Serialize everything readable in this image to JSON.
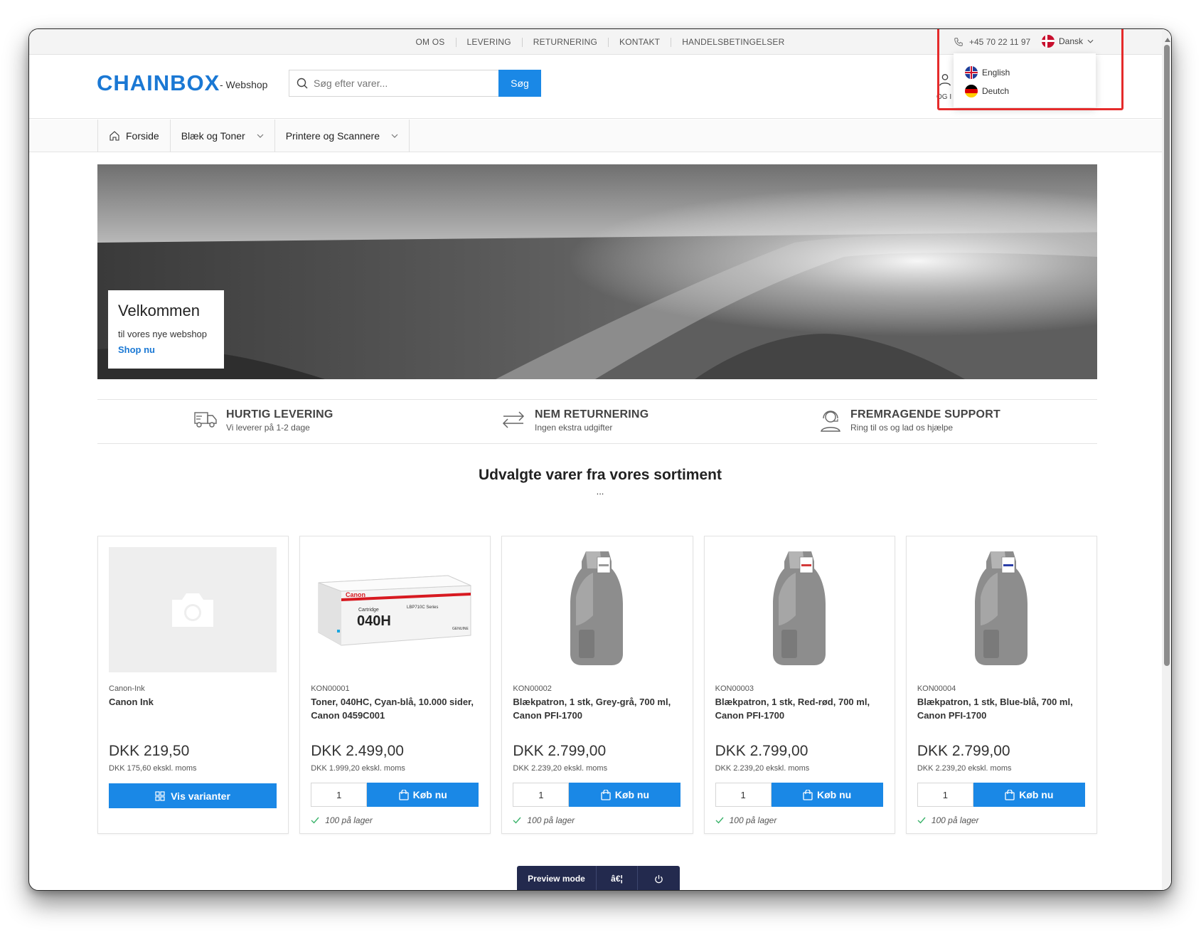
{
  "topbar": {
    "links": [
      "OM OS",
      "LEVERING",
      "RETURNERING",
      "KONTAKT",
      "HANDELSBETINGELSER"
    ],
    "phone": "+45 70 22 11 97",
    "language": "Dansk",
    "language_options": [
      "English",
      "Deutch"
    ]
  },
  "header": {
    "logo": "CHAINBOX",
    "logo_sub": "- Webshop",
    "search_placeholder": "Søg efter varer...",
    "search_button": "Søg",
    "account_label": "OG I"
  },
  "nav": {
    "items": [
      {
        "label": "Forside",
        "icon": "home-icon"
      },
      {
        "label": "Blæk og Toner",
        "icon": "chevron-down-icon"
      },
      {
        "label": "Printere og Scannere",
        "icon": "chevron-down-icon"
      }
    ]
  },
  "hero": {
    "title": "Velkommen",
    "text": "til vores nye webshop",
    "link": "Shop nu"
  },
  "features": [
    {
      "title": "HURTIG LEVERING",
      "sub": "Vi leverer på 1-2 dage",
      "icon": "truck-icon"
    },
    {
      "title": "NEM RETURNERING",
      "sub": "Ingen ekstra udgifter",
      "icon": "return-arrows-icon"
    },
    {
      "title": "FREMRAGENDE SUPPORT",
      "sub": "Ring til os og lad os hjælpe",
      "icon": "support-headset-icon"
    }
  ],
  "section": {
    "title": "Udvalgte varer fra vores sortiment",
    "dots": "..."
  },
  "products": [
    {
      "sku": "Canon-Ink",
      "name": "Canon Ink",
      "price": "DKK 219,50",
      "price_ex": "DKK 175,60 ekskl. moms",
      "button": "Vis varianter",
      "image": "placeholder"
    },
    {
      "sku": "KON00001",
      "name": "Toner, 040HC, Cyan-blå, 10.000 sider, Canon 0459C001",
      "price": "DKK 2.499,00",
      "price_ex": "DKK 1.999,20 ekskl. moms",
      "qty": "1",
      "button": "Køb nu",
      "stock": "100 på lager",
      "image": "toner-box"
    },
    {
      "sku": "KON00002",
      "name": "Blækpatron, 1 stk, Grey-grå, 700 ml, Canon PFI-1700",
      "price": "DKK 2.799,00",
      "price_ex": "DKK 2.239,20 ekskl. moms",
      "qty": "1",
      "button": "Køb nu",
      "stock": "100 på lager",
      "image": "ink-cartridge",
      "accent": "#9a9a9a"
    },
    {
      "sku": "KON00003",
      "name": "Blækpatron, 1 stk, Red-rød, 700 ml, Canon PFI-1700",
      "price": "DKK 2.799,00",
      "price_ex": "DKK 2.239,20 ekskl. moms",
      "qty": "1",
      "button": "Køb nu",
      "stock": "100 på lager",
      "image": "ink-cartridge",
      "accent": "#d23a3a"
    },
    {
      "sku": "KON00004",
      "name": "Blækpatron, 1 stk, Blue-blå, 700 ml, Canon PFI-1700",
      "price": "DKK 2.799,00",
      "price_ex": "DKK 2.239,20 ekskl. moms",
      "qty": "1",
      "button": "Køb nu",
      "stock": "100 på lager",
      "image": "ink-cartridge",
      "accent": "#2b3fa8"
    }
  ],
  "toner_box": {
    "brand": "Canon",
    "cartridge_label": "Cartridge",
    "model": "040H",
    "series": "LBP710C Series",
    "genuine": "GENUINE"
  },
  "preview_bar": {
    "label": "Preview mode",
    "middle": "â€¦",
    "power_icon": "power-icon"
  },
  "colors": {
    "brand": "#1a78d4",
    "button": "#1a88e6",
    "highlight": "#e52b2b",
    "preview_bg": "#232a4e"
  }
}
